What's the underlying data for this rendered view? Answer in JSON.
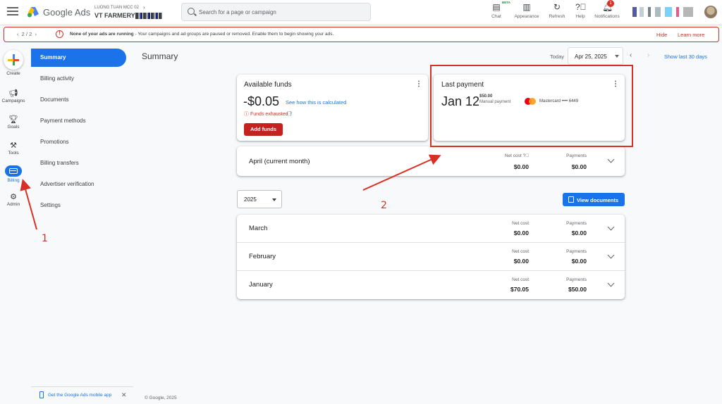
{
  "header": {
    "brand": "Google Ads",
    "account_sub": "LUONG TUAN MCC 02",
    "account_name": "VT FARMERY",
    "search_placeholder": "Search for a page or campaign",
    "chat_label": "Chat",
    "chat_beta": "BETA",
    "appearance_label": "Appearance",
    "refresh_label": "Refresh",
    "help_label": "Help",
    "notifications_label": "Notifications",
    "notifications_count": "1"
  },
  "alert": {
    "pager": "2 / 2",
    "message_bold": "None of your ads are running",
    "message_rest": " - Your campaigns and ad groups are paused or removed. Enable them to begin showing your ads.",
    "hide": "Hide",
    "learn_more": "Learn more"
  },
  "rail": {
    "create": "Create",
    "campaigns": "Campaigns",
    "goals": "Goals",
    "tools": "Tools",
    "billing": "Billing",
    "admin": "Admin"
  },
  "sidenav": {
    "items": [
      "Summary",
      "Billing activity",
      "Documents",
      "Payment methods",
      "Promotions",
      "Billing transfers",
      "Advertiser verification",
      "Settings"
    ],
    "mobile_app": "Get the Google Ads mobile app"
  },
  "footer": "© Google, 2025",
  "summary": {
    "title": "Summary",
    "today": "Today",
    "date": "Apr 25, 2025",
    "show_last": "Show last 30 days"
  },
  "available_funds": {
    "title": "Available funds",
    "amount": "-$0.05",
    "calc_link": "See how this is calculated",
    "status": "Funds exhausted",
    "add_funds": "Add funds"
  },
  "last_payment": {
    "title": "Last payment",
    "date": "Jan 12",
    "amount": "$50.00",
    "method": "Manual payment",
    "card": "Mastercard •••• 6449"
  },
  "current_month": {
    "label": "April (current month)",
    "net_cost_label": "Net cost",
    "net_cost": "$0.00",
    "payments_label": "Payments",
    "payments": "$0.00"
  },
  "year_select": "2025",
  "view_documents": "View documents",
  "months": [
    {
      "label": "March",
      "net_cost_label": "Net cost",
      "net_cost": "$0.00",
      "payments_label": "Payments",
      "payments": "$0.00"
    },
    {
      "label": "February",
      "net_cost_label": "Net cost",
      "net_cost": "$0.00",
      "payments_label": "Payments",
      "payments": "$0.00"
    },
    {
      "label": "January",
      "net_cost_label": "Net cost",
      "net_cost": "$70.05",
      "payments_label": "Payments",
      "payments": "$50.00"
    }
  ],
  "annotations": {
    "one": "1",
    "two": "2",
    "color": "#d93025"
  },
  "colors": {
    "accent": "#1a73e8",
    "error": "#d93025",
    "add_funds": "#c5221f"
  }
}
